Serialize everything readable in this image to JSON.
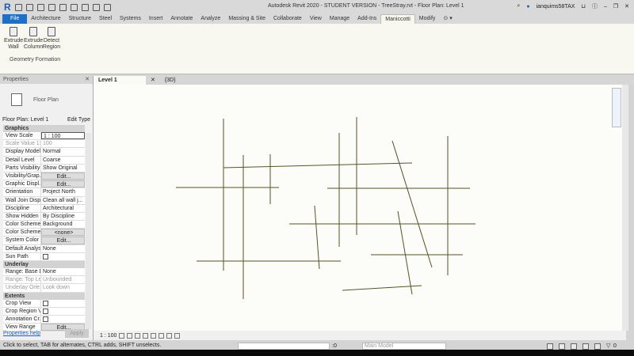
{
  "app": {
    "logo": "R",
    "title": "Autodesk Revit 2020 - STUDENT VERSION - TreeStray.rvt - Floor Plan: Level 1",
    "user": "ianquims58TAX"
  },
  "tabs": [
    "File",
    "Architecture",
    "Structure",
    "Steel",
    "Systems",
    "Insert",
    "Annotate",
    "Analyze",
    "Massing & Site",
    "Collaborate",
    "View",
    "Manage",
    "Add-Ins",
    "Maniccotti",
    "Modify"
  ],
  "ribbon": {
    "buttons": [
      {
        "l1": "Extrude",
        "l2": "Wall"
      },
      {
        "l1": "Extrude",
        "l2": "Column"
      },
      {
        "l1": "Detect",
        "l2": "Region"
      }
    ],
    "panel": "Geometry Formation"
  },
  "properties": {
    "title": "Properties",
    "type": "Floor Plan",
    "selector": "Floor Plan: Level 1",
    "edit_type": "Edit Type",
    "sections": [
      {
        "name": "Graphics",
        "rows": [
          [
            "View Scale",
            "1 : 100"
          ],
          [
            "Scale Value    1:",
            "100"
          ],
          [
            "Display Model",
            "Normal"
          ],
          [
            "Detail Level",
            "Coarse"
          ],
          [
            "Parts Visibility",
            "Show Original"
          ],
          [
            "Visibility/Grap...",
            "Edit..."
          ],
          [
            "Graphic Displ...",
            "Edit..."
          ],
          [
            "Orientation",
            "Project North"
          ],
          [
            "Wall Join Disp...",
            "Clean all wall j..."
          ],
          [
            "Discipline",
            "Architectural"
          ],
          [
            "Show Hidden ...",
            "By Discipline"
          ],
          [
            "Color Scheme ...",
            "Background"
          ],
          [
            "Color Scheme",
            "<none>"
          ],
          [
            "System Color ...",
            "Edit..."
          ],
          [
            "Default Analys...",
            "None"
          ],
          [
            "Sun Path",
            ""
          ]
        ]
      },
      {
        "name": "Underlay",
        "rows": [
          [
            "Range: Base L...",
            "None"
          ],
          [
            "Range: Top Le...",
            "Unbounded"
          ],
          [
            "Underlay Orie...",
            "Look down"
          ]
        ]
      },
      {
        "name": "Extents",
        "rows": [
          [
            "Crop View",
            ""
          ],
          [
            "Crop Region V...",
            ""
          ],
          [
            "Annotation Cr...",
            ""
          ],
          [
            "View Range",
            "Edit..."
          ]
        ]
      }
    ],
    "help": "Properties help",
    "apply": "Apply"
  },
  "view_tabs": [
    "Level 1",
    "{3D}"
  ],
  "view_control": {
    "scale": "1 : 100"
  },
  "status": {
    "message": "Click to select, TAB for alternates, CTRL adds, SHIFT unselects.",
    "zero": ":0",
    "model": "Main Model",
    "filter": "0"
  }
}
